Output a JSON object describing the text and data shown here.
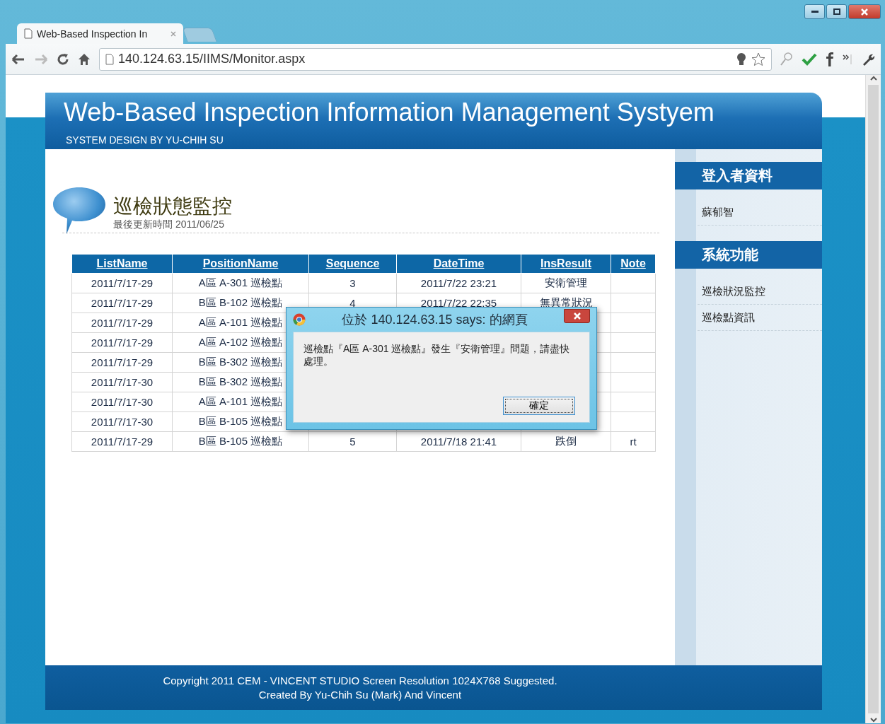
{
  "browser": {
    "tabs": [
      {
        "title": "Web-Based Inspection In",
        "selected": true
      },
      {
        "selected": false
      }
    ],
    "address": "140.124.63.15/IIMS/Monitor.aspx"
  },
  "header": {
    "title": "Web-Based Inspection Information Management Systyem",
    "subtitle": "SYSTEM DESIGN BY YU-CHIH SU"
  },
  "section": {
    "heading": "巡檢狀態監控",
    "updated": "最後更新時間 2011/06/25"
  },
  "table": {
    "columns": [
      "ListName",
      "PositionName",
      "Sequence",
      "DateTime",
      "InsResult",
      "Note"
    ],
    "rows": [
      {
        "cells": [
          "2011/7/17-29",
          "A區 A-301 巡檢點",
          "3",
          "2011/7/22 23:21",
          "安衛管理",
          null
        ]
      },
      {
        "cells": [
          "2011/7/17-29",
          "B區 B-102 巡檢點",
          "4",
          "2011/7/22 22:35",
          "無異常狀況",
          null
        ]
      },
      {
        "cells": [
          "2011/7/17-29",
          "A區 A-101 巡檢點",
          null,
          null,
          null,
          null
        ]
      },
      {
        "cells": [
          "2011/7/17-29",
          "A區 A-102 巡檢點",
          null,
          null,
          null,
          null
        ]
      },
      {
        "cells": [
          "2011/7/17-29",
          "B區 B-302 巡檢點",
          null,
          null,
          null,
          null
        ]
      },
      {
        "cells": [
          "2011/7/17-30",
          "B區 B-302 巡檢點",
          null,
          null,
          null,
          null
        ]
      },
      {
        "cells": [
          "2011/7/17-30",
          "A區 A-101 巡檢點",
          null,
          null,
          null,
          null
        ]
      },
      {
        "cells": [
          "2011/7/17-30",
          "B區 B-105 巡檢點",
          null,
          null,
          null,
          null
        ]
      },
      {
        "cells": [
          "2011/7/17-29",
          "B區 B-105 巡檢點",
          "5",
          "2011/7/18 21:41",
          "跌倒",
          "rt"
        ]
      }
    ]
  },
  "sidebar": [
    {
      "heading": "登入者資料",
      "items": [
        "蘇郁智"
      ]
    },
    {
      "heading": "系統功能",
      "items": [
        "巡檢狀況監控",
        "巡檢點資訊"
      ]
    }
  ],
  "footer": [
    "Copyright 2011 CEM - VINCENT STUDIO Screen Resolution 1024X768 Suggested.",
    "Created By Yu-Chih Su (Mark) And Vincent"
  ],
  "dialog": {
    "title": "位於 140.124.63.15 says: 的網頁",
    "message": "巡檢點『A區 A-301 巡檢點』發生『安衛管理』問題，請盡快處理。",
    "button": "確定"
  }
}
